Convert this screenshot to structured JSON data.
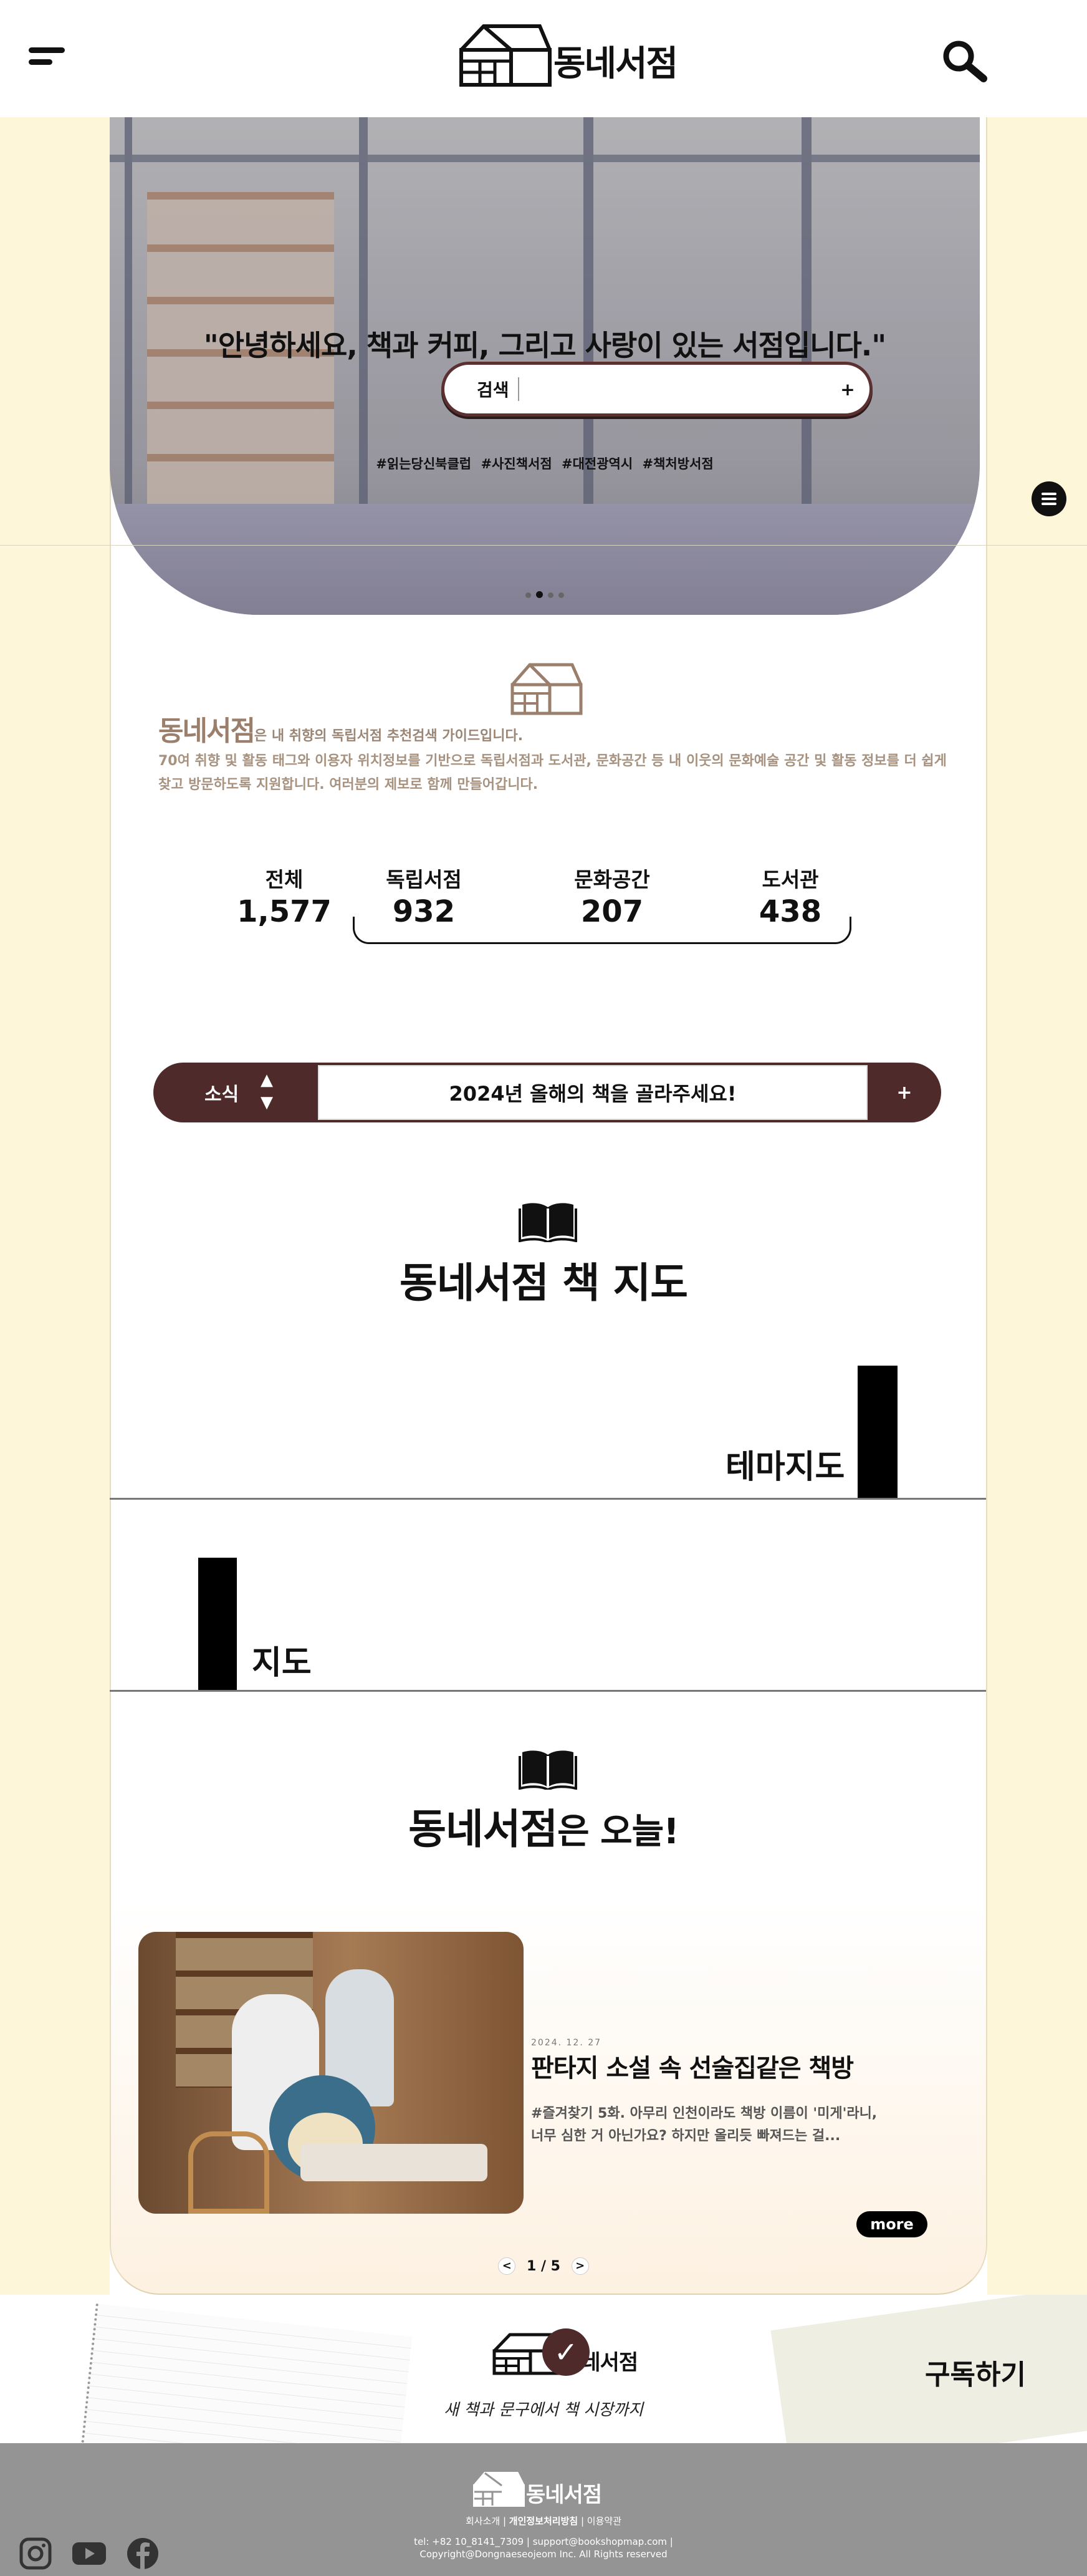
{
  "header": {
    "logo_text": "동네서점"
  },
  "hero": {
    "quote": "\"안녕하세요, 책과 커피, 그리고 사랑이 있는 서점입니다.\"",
    "search_label": "검색",
    "search_value": "",
    "search_button": "+",
    "tags": [
      "#읽는당신북클럽",
      "#사진책서점",
      "#대전광역시",
      "#책처방서점"
    ],
    "slide_count": 4,
    "active_slide": 2
  },
  "intro": {
    "brand": "동네서점",
    "line1_rest": "은 내 취향의 독립서점 추천검색 가이드입니다.",
    "line2": "70여 취향 및 활동 태그와 이용자 위치정보를 기반으로 독립서점과 도서관, 문화공간 등 내 이웃의 문화예술 공간 및 활동 정보를 더 쉽게 찾고 방문하도록 지원합니다. 여러분의 제보로 함께 만들어갑니다."
  },
  "stats": [
    {
      "label": "전체",
      "value": "1,577"
    },
    {
      "label": "독립서점",
      "value": "932"
    },
    {
      "label": "문화공간",
      "value": "207"
    },
    {
      "label": "도서관",
      "value": "438"
    }
  ],
  "news": {
    "label": "소식",
    "up_arrow": "▲",
    "down_arrow": "▼",
    "headline": "2024년 올해의 책을 골라주세요!",
    "plus": "+"
  },
  "book_map": {
    "title": "동네서점 책 지도",
    "theme_label": "테마지도",
    "map_label": "지도"
  },
  "today": {
    "title_brand": "동네서점",
    "title_rest": "은 오늘!",
    "date": "2024. 12. 27",
    "post_title": "판타지 소설 속 선술집같은 책방",
    "post_excerpt_1": "#즐겨찾기 5화. 아무리 인천이라도 책방 이름이 '미게'라니,",
    "post_excerpt_2": "너무 심한 거 아닌가요? 하지만 올리듯 빠져드는 걸...",
    "more": "more",
    "page_prev": "<",
    "page_next": ">",
    "page_indicator": "1 / 5"
  },
  "subscribe": {
    "logo_text": "동네서점",
    "slogan": "새 책과 문구에서 책 시장까지",
    "button": "구독하기"
  },
  "footer": {
    "logo_text": "동네서점",
    "links": [
      "회사소개",
      "개인정보처리방침",
      "이용약관"
    ],
    "contact": "tel: +82 10_8141_7309 | support@bookshopmap.com |",
    "copyright": "Copyright@Dongnaeseojeom Inc. All Rights reserved",
    "social": [
      "instagram-icon",
      "youtube-icon",
      "facebook-icon"
    ]
  },
  "colors": {
    "accent": "#4e2a2a",
    "side_bg": "#fdf6d8",
    "footer_bg": "#949494",
    "intro_text": "#9b8574"
  }
}
